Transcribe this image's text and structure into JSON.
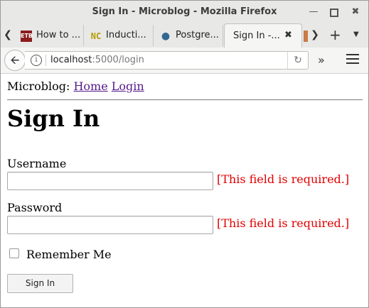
{
  "window": {
    "title": "Sign In - Microblog - Mozilla Firefox"
  },
  "tabs": [
    {
      "label": "How to ...",
      "favicon": "ETB"
    },
    {
      "label": "Inducti...",
      "favicon": "NC"
    },
    {
      "label": "Postgre...",
      "favicon": "elephant"
    },
    {
      "label": "Sign In -..."
    }
  ],
  "navbar": {
    "url_host": "localhost",
    "url_rest": ":5000/login"
  },
  "page": {
    "site_name": "Microblog:",
    "nav_home": "Home",
    "nav_login": "Login",
    "heading": "Sign In",
    "username_label": "Username",
    "username_value": "",
    "username_error": "[This field is required.]",
    "password_label": "Password",
    "password_value": "",
    "password_error": "[This field is required.]",
    "remember_label": "Remember Me",
    "remember_checked": false,
    "submit_label": "Sign In"
  },
  "colors": {
    "error": "#e00000",
    "link_visited": "#551a8b"
  }
}
